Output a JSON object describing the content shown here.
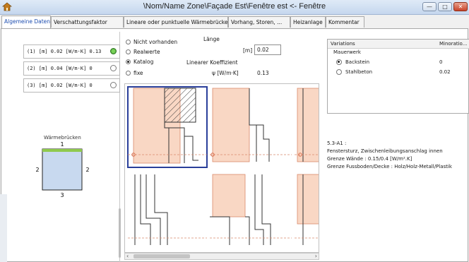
{
  "window": {
    "title": "\\Nom/Name Zone\\Façade Est\\Fenêtre est <- Fenêtre",
    "buttons": {
      "minimize": "—",
      "maximize": "□",
      "close": "✕"
    }
  },
  "tabs": [
    {
      "label": "Algemeine Daten",
      "active": true
    },
    {
      "label": "Verschattungsfaktor",
      "active": false
    },
    {
      "label": "Lineare oder punktuelle Wärmebrücke:",
      "active": false
    },
    {
      "label": "Vorhang, Storen, ...",
      "active": false
    },
    {
      "label": "Heizanlage",
      "active": false
    },
    {
      "label": "Kommentar",
      "active": false
    }
  ],
  "bridge_list": [
    {
      "label": "(1)  [m] 0.02  [W/m·K]  0.13",
      "selected": true
    },
    {
      "label": "(2)  [m] 0.04  [W/m·K]  0",
      "selected": false
    },
    {
      "label": "(3)  [m] 0.02  [W/m·K]  0",
      "selected": false
    }
  ],
  "thermal_bridge_box": {
    "title": "Wärmebrücken",
    "numbers": {
      "top": "1",
      "left": "2",
      "right": "2",
      "bottom": "3"
    }
  },
  "value_source": {
    "options": [
      {
        "label": "Nicht vorhanden",
        "selected": false
      },
      {
        "label": "Realwerte",
        "selected": false
      },
      {
        "label": "Katalog",
        "selected": true
      },
      {
        "label": "fixe",
        "selected": false
      }
    ],
    "length_header": "Länge",
    "length_unit": "[m]",
    "length_value": "0.02",
    "coef_header": "Linearer Koeffizient",
    "coef_unit": "ψ [W/m·K]",
    "coef_value": "0.13"
  },
  "variations": {
    "columns": [
      "Variations",
      "Minoratio..."
    ],
    "group": "Mauerwerk",
    "rows": [
      {
        "label": "Backstein",
        "value": "0",
        "selected": true
      },
      {
        "label": "Stahlbeton",
        "value": "0.02",
        "selected": false
      }
    ]
  },
  "info": {
    "code": "5.3-A1 :",
    "line1": "Fenstersturz, Zwischenleibungsanschlag innen",
    "line2": "Grenze Wände : 0.15/0.4 [W/m².K]",
    "line3": "Grenze Fussboden/Decke : Holz/Holz-Metall/Plastik"
  },
  "colors": {
    "accent": "#1f4fb0",
    "insulation": "#f9d7c4",
    "wall_line": "#d98a6c",
    "selected_frame": "#2a3f9a",
    "green_bar": "#8fca4d",
    "blue_fill": "#c8d9ef"
  },
  "icons": {
    "app": "house-icon",
    "scroll_left": "chevron-left-icon",
    "scroll_right": "chevron-right-icon"
  }
}
